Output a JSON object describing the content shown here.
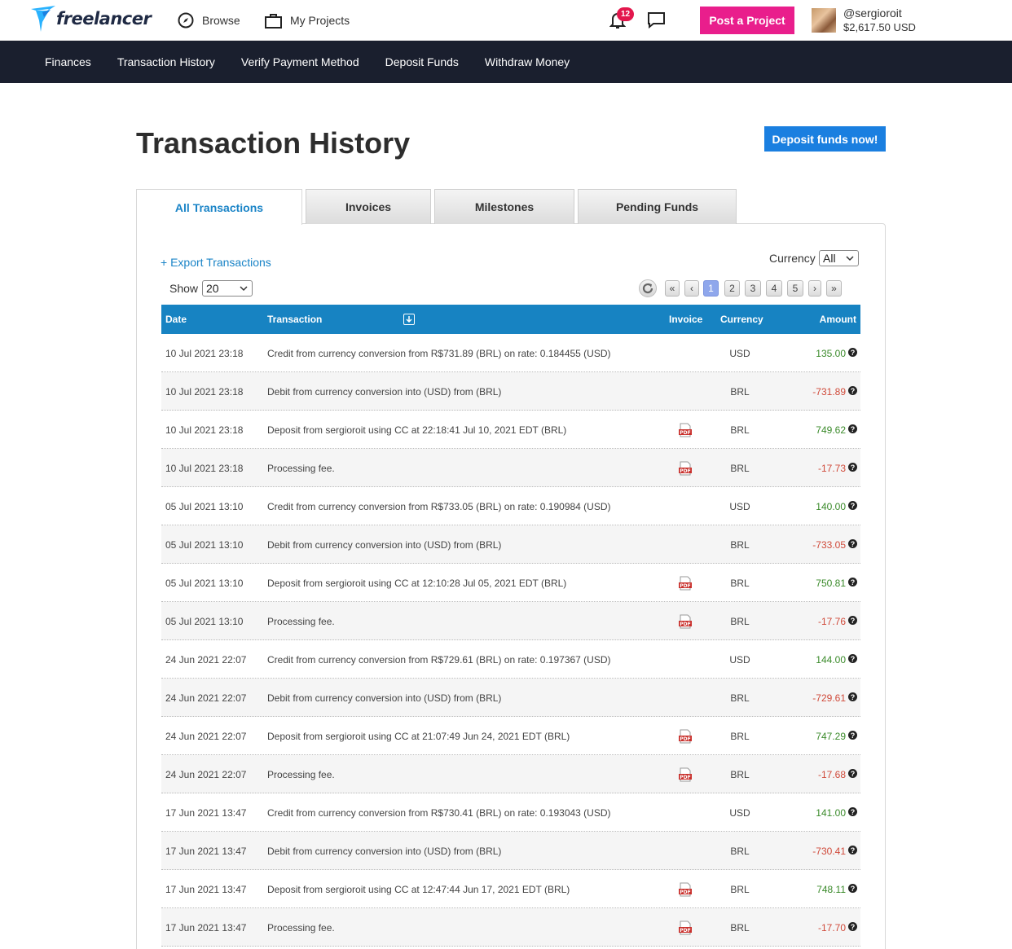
{
  "header": {
    "logo_text": "freelancer",
    "browse_label": "Browse",
    "projects_label": "My Projects",
    "notification_count": "12",
    "post_button": "Post a Project",
    "username": "@sergioroit",
    "balance": "$2,617.50 USD"
  },
  "subnav": {
    "items": [
      "Finances",
      "Transaction History",
      "Verify Payment Method",
      "Deposit Funds",
      "Withdraw Money"
    ]
  },
  "page": {
    "title": "Transaction History",
    "deposit_button": "Deposit funds now!"
  },
  "tabs": [
    "All Transactions",
    "Invoices",
    "Milestones",
    "Pending Funds"
  ],
  "controls": {
    "export_link": "+ Export Transactions",
    "show_label": "Show",
    "show_value": "20",
    "currency_label": "Currency",
    "currency_value": "All",
    "pagination": [
      "«",
      "‹",
      "1",
      "2",
      "3",
      "4",
      "5",
      "›",
      "»"
    ],
    "current_page": "1"
  },
  "table": {
    "headers": {
      "date": "Date",
      "transaction": "Transaction",
      "invoice": "Invoice",
      "currency": "Currency",
      "amount": "Amount"
    },
    "rows": [
      {
        "date": "10 Jul 2021 23:18",
        "desc": "Credit from currency conversion from R$731.89 (BRL) on rate: 0.184455 (USD)",
        "invoice": false,
        "currency": "USD",
        "amount": "135.00",
        "sign": "pos"
      },
      {
        "date": "10 Jul 2021 23:18",
        "desc": "Debit from currency conversion into (USD) from (BRL)",
        "invoice": false,
        "currency": "BRL",
        "amount": "-731.89",
        "sign": "neg"
      },
      {
        "date": "10 Jul 2021 23:18",
        "desc": "Deposit from sergioroit using CC at 22:18:41 Jul 10, 2021 EDT (BRL)",
        "invoice": true,
        "currency": "BRL",
        "amount": "749.62",
        "sign": "pos"
      },
      {
        "date": "10 Jul 2021 23:18",
        "desc": "Processing fee.",
        "invoice": true,
        "currency": "BRL",
        "amount": "-17.73",
        "sign": "neg"
      },
      {
        "date": "05 Jul 2021 13:10",
        "desc": "Credit from currency conversion from R$733.05 (BRL) on rate: 0.190984 (USD)",
        "invoice": false,
        "currency": "USD",
        "amount": "140.00",
        "sign": "pos"
      },
      {
        "date": "05 Jul 2021 13:10",
        "desc": "Debit from currency conversion into (USD) from (BRL)",
        "invoice": false,
        "currency": "BRL",
        "amount": "-733.05",
        "sign": "neg"
      },
      {
        "date": "05 Jul 2021 13:10",
        "desc": "Deposit from sergioroit using CC at 12:10:28 Jul 05, 2021 EDT (BRL)",
        "invoice": true,
        "currency": "BRL",
        "amount": "750.81",
        "sign": "pos"
      },
      {
        "date": "05 Jul 2021 13:10",
        "desc": "Processing fee.",
        "invoice": true,
        "currency": "BRL",
        "amount": "-17.76",
        "sign": "neg"
      },
      {
        "date": "24 Jun 2021 22:07",
        "desc": "Credit from currency conversion from R$729.61 (BRL) on rate: 0.197367 (USD)",
        "invoice": false,
        "currency": "USD",
        "amount": "144.00",
        "sign": "pos"
      },
      {
        "date": "24 Jun 2021 22:07",
        "desc": "Debit from currency conversion into (USD) from (BRL)",
        "invoice": false,
        "currency": "BRL",
        "amount": "-729.61",
        "sign": "neg"
      },
      {
        "date": "24 Jun 2021 22:07",
        "desc": "Deposit from sergioroit using CC at 21:07:49 Jun 24, 2021 EDT (BRL)",
        "invoice": true,
        "currency": "BRL",
        "amount": "747.29",
        "sign": "pos"
      },
      {
        "date": "24 Jun 2021 22:07",
        "desc": "Processing fee.",
        "invoice": true,
        "currency": "BRL",
        "amount": "-17.68",
        "sign": "neg"
      },
      {
        "date": "17 Jun 2021 13:47",
        "desc": "Credit from currency conversion from R$730.41 (BRL) on rate: 0.193043 (USD)",
        "invoice": false,
        "currency": "USD",
        "amount": "141.00",
        "sign": "pos"
      },
      {
        "date": "17 Jun 2021 13:47",
        "desc": "Debit from currency conversion into (USD) from (BRL)",
        "invoice": false,
        "currency": "BRL",
        "amount": "-730.41",
        "sign": "neg"
      },
      {
        "date": "17 Jun 2021 13:47",
        "desc": "Deposit from sergioroit using CC at 12:47:44 Jun 17, 2021 EDT (BRL)",
        "invoice": true,
        "currency": "BRL",
        "amount": "748.11",
        "sign": "pos"
      },
      {
        "date": "17 Jun 2021 13:47",
        "desc": "Processing fee.",
        "invoice": true,
        "currency": "BRL",
        "amount": "-17.70",
        "sign": "neg"
      }
    ]
  },
  "colors": {
    "brand_blue": "#1783c2",
    "post_pink": "#e91e8c",
    "subnav_bg": "#1a1f2e",
    "positive": "#3a8a2a",
    "negative": "#d04a3a"
  }
}
